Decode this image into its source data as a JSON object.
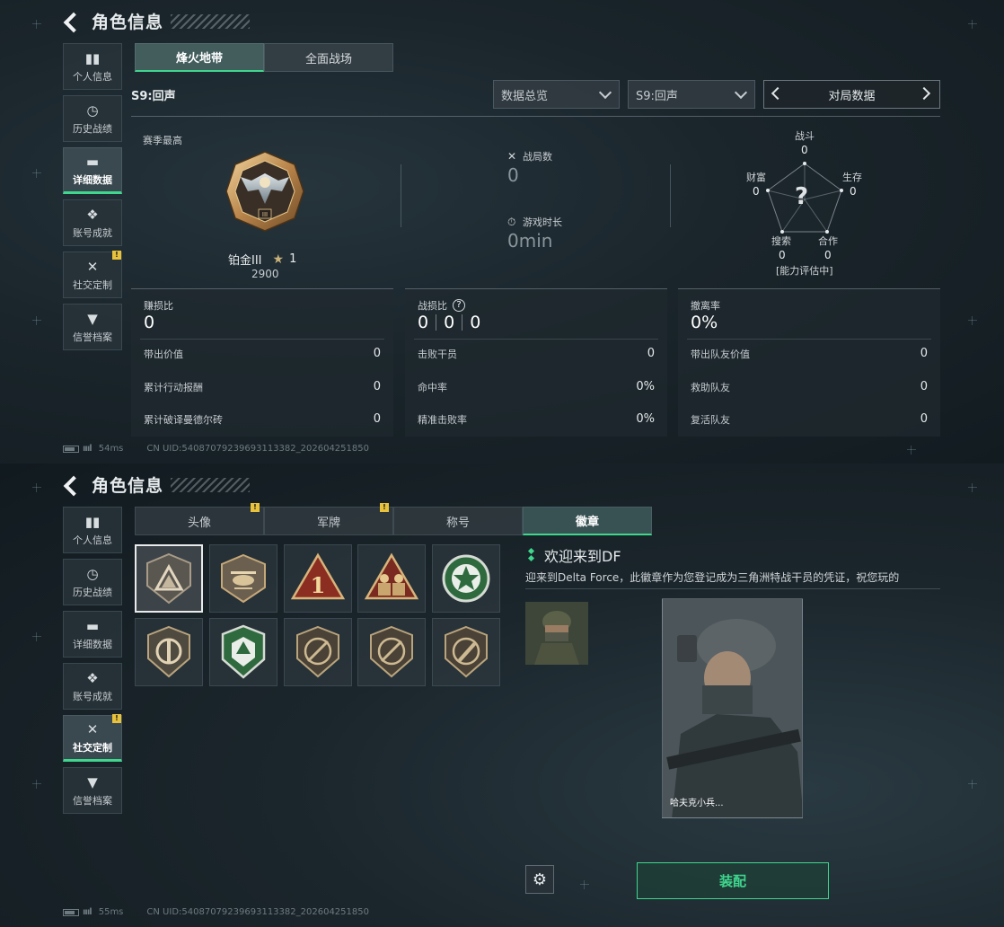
{
  "top": {
    "header": {
      "title": "角色信息"
    },
    "sidebar": {
      "items": [
        {
          "label": "个人信息",
          "icon": "bar-chart-icon"
        },
        {
          "label": "历史战绩",
          "icon": "history-icon"
        },
        {
          "label": "详细数据",
          "icon": "folder-icon",
          "active": true
        },
        {
          "label": "账号成就",
          "icon": "achievement-icon"
        },
        {
          "label": "社交定制",
          "icon": "tools-icon",
          "badge": "!"
        },
        {
          "label": "信誉档案",
          "icon": "shield-icon"
        }
      ]
    },
    "tabs": [
      {
        "label": "烽火地带",
        "active": true
      },
      {
        "label": "全面战场"
      }
    ],
    "season_title": "S9:回声",
    "filters": {
      "overview": "数据总览",
      "season": "S9:回声",
      "pager_label": "对局数据"
    },
    "season_best": {
      "label": "赛季最高",
      "rank": "铂金III",
      "stars": "1",
      "score": "2900"
    },
    "summary": {
      "matches_label": "战局数",
      "matches_value": "0",
      "playtime_label": "游戏时长",
      "playtime_value": "0min"
    },
    "radar": {
      "combat_label": "战斗",
      "combat_value": "0",
      "survival_label": "生存",
      "survival_value": "0",
      "coop_label": "合作",
      "coop_value": "0",
      "search_label": "搜索",
      "search_value": "0",
      "wealth_label": "财富",
      "wealth_value": "0",
      "status": "[能力评估中]",
      "center": "?"
    },
    "cards": [
      {
        "title": "赚损比",
        "value": "0",
        "rows": [
          {
            "label": "带出价值",
            "value": "0"
          },
          {
            "label": "累计行动报酬",
            "value": "0"
          },
          {
            "label": "累计破译曼德尔砖",
            "value": "0"
          }
        ]
      },
      {
        "title": "战损比",
        "help": "?",
        "values": [
          "0",
          "0",
          "0"
        ],
        "rows": [
          {
            "label": "击败干员",
            "value": "0"
          },
          {
            "label": "命中率",
            "value": "0%"
          },
          {
            "label": "精准击败率",
            "value": "0%"
          }
        ]
      },
      {
        "title": "撤离率",
        "value": "0%",
        "rows": [
          {
            "label": "带出队友价值",
            "value": "0"
          },
          {
            "label": "救助队友",
            "value": "0"
          },
          {
            "label": "复活队友",
            "value": "0"
          }
        ]
      }
    ],
    "status": {
      "signal": "ıııl",
      "ping": "54ms",
      "uid": "CN UID:5408707923969311338​2_202604251850"
    }
  },
  "bottom": {
    "header": {
      "title": "角色信息"
    },
    "sidebar": {
      "items": [
        {
          "label": "个人信息",
          "icon": "bar-chart-icon"
        },
        {
          "label": "历史战绩",
          "icon": "history-icon"
        },
        {
          "label": "详细数据",
          "icon": "folder-icon"
        },
        {
          "label": "账号成就",
          "icon": "achievement-icon"
        },
        {
          "label": "社交定制",
          "icon": "tools-icon",
          "badge": "!",
          "active": true
        },
        {
          "label": "信誉档案",
          "icon": "shield-icon"
        }
      ]
    },
    "tabs": [
      {
        "label": "头像",
        "badge": "!"
      },
      {
        "label": "军牌",
        "badge": "!"
      },
      {
        "label": "称号"
      },
      {
        "label": "徽章",
        "active": true
      }
    ],
    "badges": [
      "triangle-emblem-icon",
      "helicopter-emblem-icon",
      "number-one-emblem-icon",
      "soldiers-emblem-icon",
      "star-wreath-emblem-icon",
      "shield-roundel-emblem-icon",
      "green-shield-emblem-icon",
      "rifle-emblem-icon",
      "rifle-emblem-icon",
      "knife-emblem-icon"
    ],
    "detail": {
      "title": "欢迎来到DF",
      "description": "迎来到Delta Force，此徽章作为您登记成为三角洲特战干员的凭证，祝您玩的",
      "card_name": "哈夫克小兵..."
    },
    "equip_label": "装配",
    "status": {
      "signal": "ıııl",
      "ping": "55ms",
      "uid": "CN UID:54087079239693113382_202604251850"
    }
  },
  "colors": {
    "accent": "#3fd68e",
    "warning": "#e8c23a",
    "gold": "#c9b27a"
  }
}
